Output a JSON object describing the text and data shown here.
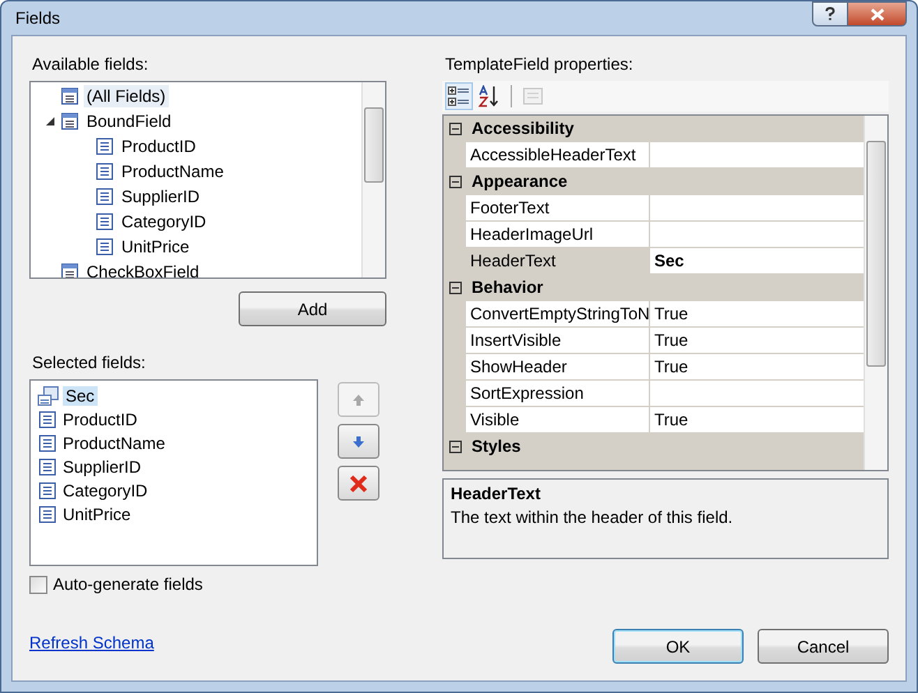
{
  "window": {
    "title": "Fields"
  },
  "available_fields": {
    "label": "Available fields:",
    "tree": [
      {
        "label": "(All Fields)",
        "selected": true,
        "expanded": false
      },
      {
        "label": "BoundField",
        "selected": false,
        "expanded": true,
        "children": [
          {
            "label": "ProductID",
            "selected": false
          },
          {
            "label": "ProductName",
            "selected": false
          },
          {
            "label": "SupplierID",
            "selected": false
          },
          {
            "label": "CategoryID",
            "selected": false
          },
          {
            "label": "UnitPrice",
            "selected": false
          }
        ]
      },
      {
        "label": "CheckBoxField",
        "selected": false,
        "expanded": false
      }
    ]
  },
  "add_button": "Add",
  "selected_fields": {
    "label": "Selected fields:",
    "items": [
      {
        "label": "Sec",
        "selected": true,
        "kind": "template"
      },
      {
        "label": "ProductID",
        "selected": false,
        "kind": "bound"
      },
      {
        "label": "ProductName",
        "selected": false,
        "kind": "bound"
      },
      {
        "label": "SupplierID",
        "selected": false,
        "kind": "bound"
      },
      {
        "label": "CategoryID",
        "selected": false,
        "kind": "bound"
      },
      {
        "label": "UnitPrice",
        "selected": false,
        "kind": "bound"
      }
    ]
  },
  "move_buttons": [
    {
      "kind": "up",
      "disabled": true
    },
    {
      "kind": "down",
      "disabled": false
    },
    {
      "kind": "delete",
      "disabled": false
    }
  ],
  "auto_generate": {
    "label": "Auto-generate fields",
    "checked": false
  },
  "refresh_link": "Refresh Schema",
  "properties": {
    "label": "TemplateField properties:",
    "toolbar": [
      {
        "kind": "categorized",
        "selected": true,
        "disabled": false
      },
      {
        "kind": "alphabetical",
        "selected": false,
        "disabled": false
      },
      {
        "kind": "pages",
        "selected": false,
        "disabled": true
      }
    ],
    "categories": [
      {
        "name": "Accessibility",
        "expanded": true,
        "rows": [
          {
            "name": "AccessibleHeaderText",
            "value": "",
            "selected": false,
            "modified": false
          }
        ]
      },
      {
        "name": "Appearance",
        "expanded": true,
        "rows": [
          {
            "name": "FooterText",
            "value": "",
            "selected": false,
            "modified": false
          },
          {
            "name": "HeaderImageUrl",
            "value": "",
            "selected": false,
            "modified": false
          },
          {
            "name": "HeaderText",
            "value": "Sec",
            "selected": true,
            "modified": true
          }
        ]
      },
      {
        "name": "Behavior",
        "expanded": true,
        "rows": [
          {
            "name": "ConvertEmptyStringToN",
            "value": "True",
            "selected": false,
            "modified": false
          },
          {
            "name": "InsertVisible",
            "value": "True",
            "selected": false,
            "modified": false
          },
          {
            "name": "ShowHeader",
            "value": "True",
            "selected": false,
            "modified": false
          },
          {
            "name": "SortExpression",
            "value": "",
            "selected": false,
            "modified": false
          },
          {
            "name": "Visible",
            "value": "True",
            "selected": false,
            "modified": false
          }
        ]
      },
      {
        "name": "Styles",
        "expanded": true
      }
    ],
    "description": {
      "title": "HeaderText",
      "text": "The text within the header of this field."
    }
  },
  "buttons": [
    {
      "label": "OK",
      "kind": "default"
    },
    {
      "label": "Cancel",
      "kind": "normal"
    }
  ]
}
